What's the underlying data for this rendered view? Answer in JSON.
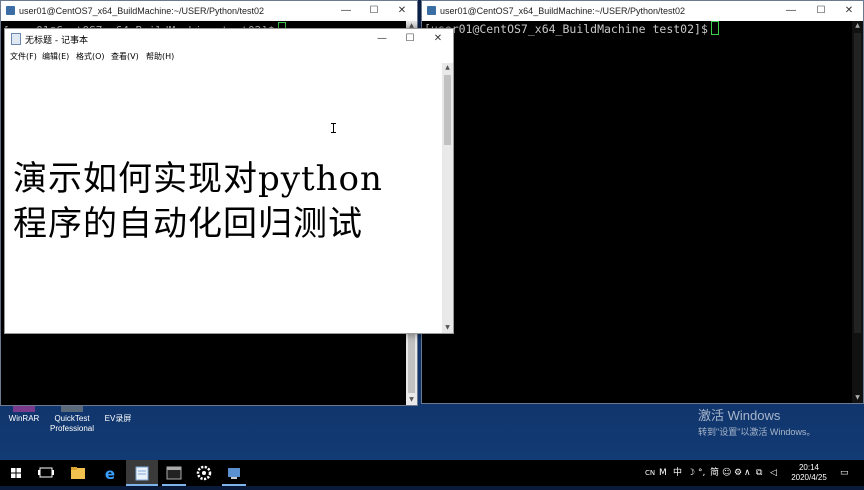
{
  "desktop_icons": [
    {
      "label": "WinRAR"
    },
    {
      "label": "QuickTest Professional"
    },
    {
      "label": "EV录屏"
    }
  ],
  "watermark": {
    "line1": "激活 Windows",
    "line2": "转到\"设置\"以激活 Windows。"
  },
  "left_terminal": {
    "title": "user01@CentOS7_x64_BuildMachine:~/USER/Python/test02",
    "prompt": "[user01@CentOS7_x64_BuildMachine test02]$"
  },
  "right_terminal": {
    "title": "user01@CentOS7_x64_BuildMachine:~/USER/Python/test02",
    "prompt": "[user01@CentOS7_x64_BuildMachine test02]$"
  },
  "notepad": {
    "title": "无标题 - 记事本",
    "menu": [
      "文件(F)",
      "编辑(E)",
      "格式(O)",
      "查看(V)",
      "帮助(H)"
    ],
    "lines": [
      "演示如何实现对python",
      "程序的自动化回归测试"
    ]
  },
  "window_controls": {
    "minimize": "—",
    "maximize": "☐",
    "close": "✕"
  },
  "taskbar": {
    "tray": {
      "lang": "CN",
      "ime_mode": "中",
      "ime_name": "简"
    },
    "clock": {
      "time": "20:14",
      "date": "2020/4/25"
    }
  },
  "colors": {
    "terminal_bg": "#000000",
    "cursor": "#3ecf4a",
    "desktop": "#0f2c5c"
  }
}
